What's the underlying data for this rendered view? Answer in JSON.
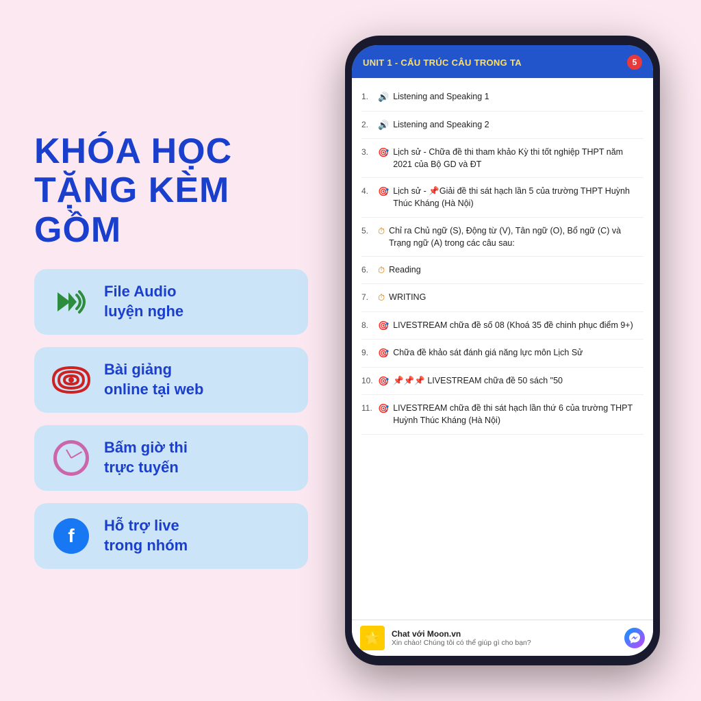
{
  "background": "#fce8f0",
  "left": {
    "title_line1": "KHÓA HỌC",
    "title_line2": "TẶNG KÈM GỒM",
    "features": [
      {
        "id": "audio",
        "icon_type": "audio",
        "text_line1": "File Audio",
        "text_line2": "luyện nghe"
      },
      {
        "id": "broadcast",
        "icon_type": "broadcast",
        "text_line1": "Bài giảng",
        "text_line2": "online tại web"
      },
      {
        "id": "clock",
        "icon_type": "clock",
        "text_line1": "Bấm giờ thi",
        "text_line2": "trực tuyến"
      },
      {
        "id": "facebook",
        "icon_type": "facebook",
        "text_line1": "Hỗ trợ live",
        "text_line2": "trong nhóm"
      }
    ]
  },
  "phone": {
    "unit_title": "UNIT 1 - CẤU TRÚC CÂU TRONG TA",
    "badge": "5",
    "lessons": [
      {
        "num": "1.",
        "icon": "🔊",
        "text": "Listening and Speaking 1"
      },
      {
        "num": "2.",
        "icon": "🔊",
        "text": "Listening and Speaking 2"
      },
      {
        "num": "3.",
        "icon": "🎯",
        "text": "Lịch sử - Chữa đề thi tham khảo Kỳ thi tốt nghiệp THPT năm 2021 của Bộ GD và ĐT"
      },
      {
        "num": "4.",
        "icon": "🎯",
        "text": "Lịch sử - 📌Giải đề thi sát hạch lần 5 của trường THPT Huỳnh Thúc Kháng (Hà Nội)"
      },
      {
        "num": "5.",
        "icon": "⏱",
        "text": "Chỉ ra Chủ ngữ (S), Động từ (V), Tân ngữ (O), Bổ ngữ (C) và Trạng ngữ (A) trong các câu sau:"
      },
      {
        "num": "6.",
        "icon": "⏱",
        "text": "Reading"
      },
      {
        "num": "7.",
        "icon": "⏱",
        "text": "WRITING"
      },
      {
        "num": "8.",
        "icon": "🎯",
        "text": "LIVESTREAM chữa đề số 08 (Khoá 35 đề chinh phục điểm 9+)"
      },
      {
        "num": "9.",
        "icon": "🎯",
        "text": "Chữa đề khảo sát đánh giá năng lực môn Lịch Sử"
      },
      {
        "num": "10.",
        "icon": "🎯",
        "text": "📌📌📌 LIVESTREAM chữa đề 50 sách \"50"
      },
      {
        "num": "11.",
        "icon": "🎯",
        "text": "LIVESTREAM chữa đề thi sát hạch lần thứ 6 của trường THPT Huỳnh Thúc Kháng (Hà Nội)"
      }
    ],
    "chat": {
      "avatar_emoji": "🌟",
      "title": "Chat với Moon.vn",
      "subtitle": "Xin chào! Chúng tôi có thể giúp gì cho bạn?"
    }
  }
}
